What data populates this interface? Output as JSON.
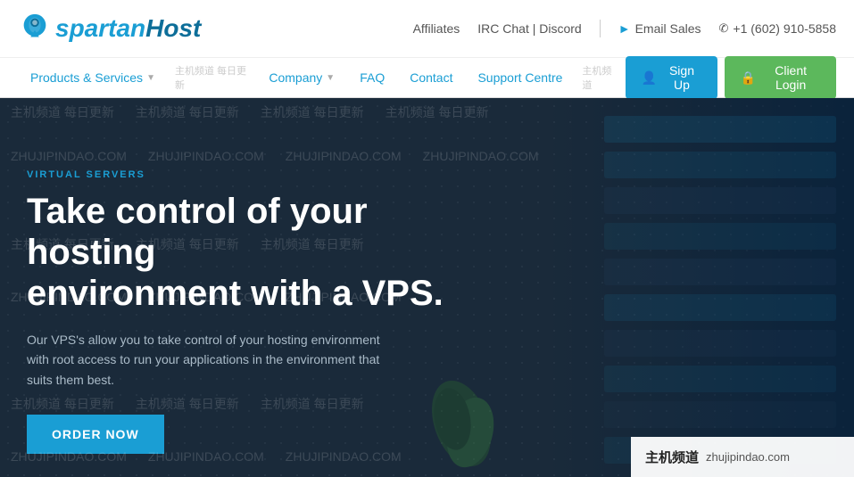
{
  "site": {
    "logo_text_part1": "spartan",
    "logo_text_part2": "Host"
  },
  "topbar": {
    "affiliates": "Affiliates",
    "irc_chat": "IRC Chat | Discord",
    "email_sales_icon": "➤",
    "email_sales_label": "Email Sales",
    "phone_icon": "📞",
    "phone_number": "+1 (602) 910-5858"
  },
  "nav": {
    "products_services": "Products & Services",
    "company": "Company",
    "faq": "FAQ",
    "contact": "Contact",
    "support_centre": "Support Centre",
    "chinese_label": "主机频道 每日更新",
    "signup_icon": "👤",
    "signup_label": "Sign Up",
    "client_icon": "🔒",
    "client_label": "Client Login"
  },
  "hero": {
    "label": "VIRTUAL SERVERS",
    "title_line1": "Take control of your hosting",
    "title_line2": "environment with a VPS.",
    "description": "Our VPS's allow you to take control of your hosting environment with root access to run your applications in the environment that suits them best.",
    "cta_button": "ORDER NOW"
  },
  "watermarks": {
    "text1": "主机频道 每日更新",
    "text2": "ZHUJIPINDAO.COM",
    "bottom_label": "主机频道",
    "bottom_url": "zhujipindao.com"
  }
}
